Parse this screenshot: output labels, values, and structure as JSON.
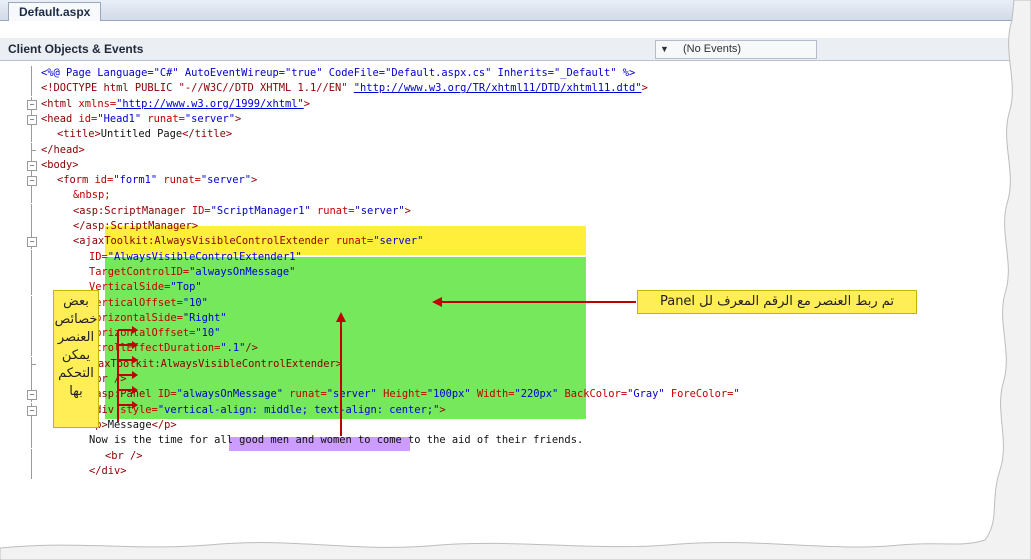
{
  "tab": {
    "label": "Default.aspx"
  },
  "nav": {
    "objects": "Client Objects & Events",
    "events": "(No Events)"
  },
  "code_lines": [
    {
      "indent": 0,
      "segments": [
        [
          "c-val",
          "<%@ Page Language=\"C#\" AutoEventWireup=\"true\" CodeFile=\"Default.aspx.cs\" Inherits=\"_Default\" %>"
        ]
      ]
    },
    {
      "indent": 0,
      "segments": [
        [
          "c-tag",
          "<!DOCTYPE html PUBLIC \"-//W3C//DTD XHTML 1.1//EN\" "
        ],
        [
          "c-url",
          "\"http://www.w3.org/TR/xhtml11/DTD/xhtml11.dtd\""
        ],
        [
          "c-tag",
          ">"
        ]
      ]
    },
    {
      "indent": 0,
      "segments": [
        [
          "c-tag",
          "<html "
        ],
        [
          "c-attr",
          "xmlns="
        ],
        [
          "c-url",
          "\"http://www.w3.org/1999/xhtml\""
        ],
        [
          "c-tag",
          ">"
        ]
      ]
    },
    {
      "indent": 0,
      "segments": [
        [
          "c-tag",
          "<head "
        ],
        [
          "c-attr",
          "id="
        ],
        [
          "c-val",
          "\"Head1\" "
        ],
        [
          "c-attr",
          "runat="
        ],
        [
          "c-val",
          "\"server\""
        ],
        [
          "c-tag",
          ">"
        ]
      ]
    },
    {
      "indent": 2,
      "segments": [
        [
          "c-tag",
          "<title>"
        ],
        [
          "c-txt",
          "Untitled Page"
        ],
        [
          "c-tag",
          "</title>"
        ]
      ]
    },
    {
      "indent": 0,
      "segments": [
        [
          "c-tag",
          "</head>"
        ]
      ]
    },
    {
      "indent": 0,
      "segments": [
        [
          "c-tag",
          "<body>"
        ]
      ]
    },
    {
      "indent": 2,
      "segments": [
        [
          "c-tag",
          "<form "
        ],
        [
          "c-attr",
          "id="
        ],
        [
          "c-val",
          "\"form1\" "
        ],
        [
          "c-attr",
          "runat="
        ],
        [
          "c-val",
          "\"server\""
        ],
        [
          "c-tag",
          ">"
        ]
      ]
    },
    {
      "indent": 4,
      "segments": [
        [
          "c-attr",
          "&nbsp;"
        ]
      ]
    },
    {
      "indent": 4,
      "segments": [
        [
          "c-tag",
          "<asp:ScriptManager "
        ],
        [
          "c-attr",
          "ID="
        ],
        [
          "c-val",
          "\"ScriptManager1\" "
        ],
        [
          "c-attr",
          "runat="
        ],
        [
          "c-val",
          "\"server\""
        ],
        [
          "c-tag",
          ">"
        ]
      ]
    },
    {
      "indent": 4,
      "segments": [
        [
          "c-tag",
          "</asp:ScriptManager>"
        ]
      ]
    },
    {
      "indent": 4,
      "segments": [
        [
          "c-tag",
          "<ajaxToolkit:AlwaysVisibleControlExtender "
        ],
        [
          "c-attr",
          "runat="
        ],
        [
          "c-val",
          "\"server\""
        ]
      ]
    },
    {
      "indent": 6,
      "segments": [
        [
          "c-attr",
          "ID="
        ],
        [
          "c-val",
          "\"AlwaysVisibleControlExtender1\""
        ]
      ]
    },
    {
      "indent": 6,
      "segments": [
        [
          "c-attr",
          "TargetControlID="
        ],
        [
          "c-val",
          "\"alwaysOnMessage\""
        ]
      ]
    },
    {
      "indent": 6,
      "segments": [
        [
          "c-attr",
          "VerticalSide="
        ],
        [
          "c-val",
          "\"Top\""
        ]
      ]
    },
    {
      "indent": 6,
      "segments": [
        [
          "c-attr",
          "VerticalOffset="
        ],
        [
          "c-val",
          "\"10\""
        ]
      ]
    },
    {
      "indent": 6,
      "segments": [
        [
          "c-attr",
          "HorizontalSide="
        ],
        [
          "c-val",
          "\"Right\""
        ]
      ]
    },
    {
      "indent": 6,
      "segments": [
        [
          "c-attr",
          "HorizontalOffset="
        ],
        [
          "c-val",
          "\"10\""
        ]
      ]
    },
    {
      "indent": 6,
      "segments": [
        [
          "c-attr",
          "ScrollEffectDuration="
        ],
        [
          "c-val",
          "\".1\""
        ],
        [
          "c-tag",
          "/>"
        ]
      ]
    },
    {
      "indent": 4,
      "segments": [
        [
          "c-tag",
          "</ajaxToolkit:AlwaysVisibleControlExtender>"
        ]
      ]
    },
    {
      "indent": 6,
      "segments": [
        [
          "c-tag",
          "<br />"
        ]
      ]
    },
    {
      "indent": 6,
      "segments": [
        [
          "c-tag",
          "<asp:Panel "
        ],
        [
          "c-attr",
          "ID="
        ],
        [
          "c-val",
          "\"alwaysOnMessage\" "
        ],
        [
          "c-attr",
          "runat="
        ],
        [
          "c-val",
          "\"server\" "
        ],
        [
          "c-attr",
          "Height="
        ],
        [
          "c-val",
          "\"100px\" "
        ],
        [
          "c-attr",
          "Width="
        ],
        [
          "c-val",
          "\"220px\" "
        ],
        [
          "c-attr",
          "BackColor="
        ],
        [
          "c-val",
          "\"Gray\" "
        ],
        [
          "c-attr",
          "ForeColor="
        ],
        [
          "c-val",
          "\""
        ]
      ]
    },
    {
      "indent": 6,
      "segments": [
        [
          "c-tag",
          "<div "
        ],
        [
          "c-attr",
          "style="
        ],
        [
          "c-val",
          "\"vertical-align: middle; text-align: center;\""
        ],
        [
          "c-tag",
          ">"
        ]
      ]
    },
    {
      "indent": 6,
      "segments": [
        [
          "c-tag",
          "<p>"
        ],
        [
          "c-txt",
          "Message"
        ],
        [
          "c-tag",
          "</p>"
        ]
      ]
    },
    {
      "indent": 6,
      "segments": [
        [
          "c-txt",
          "Now is the time for all good men and women to come to the aid of their friends."
        ]
      ]
    },
    {
      "indent": 8,
      "segments": [
        [
          "c-tag",
          "<br />"
        ]
      ]
    },
    {
      "indent": 6,
      "segments": [
        [
          "c-tag",
          "</div>"
        ]
      ]
    }
  ],
  "callouts": {
    "left_lines": [
      "بعض",
      "خصائص",
      "العنصر",
      "يمكن",
      "التحكم",
      "بها"
    ],
    "right": "تم ربط العنصر مع الرقم المعرف لل Panel"
  }
}
